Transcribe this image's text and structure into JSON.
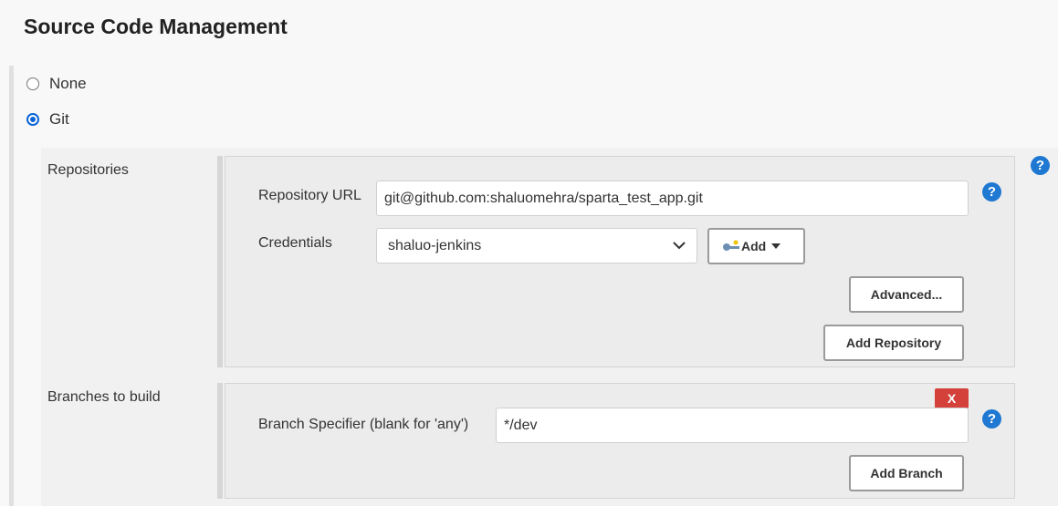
{
  "section": {
    "title": "Source Code Management"
  },
  "scm_options": [
    {
      "label": "None",
      "selected": false
    },
    {
      "label": "Git",
      "selected": true
    }
  ],
  "repositories": {
    "label": "Repositories",
    "repository_url_label": "Repository URL",
    "repository_url_value": "git@github.com:shaluomehra/sparta_test_app.git",
    "credentials_label": "Credentials",
    "credentials_value": "shaluo-jenkins",
    "add_label": "Add",
    "advanced_label": "Advanced...",
    "add_repository_label": "Add Repository"
  },
  "branches": {
    "label": "Branches to build",
    "delete_label": "X",
    "branch_specifier_label": "Branch Specifier (blank for 'any')",
    "branch_specifier_value": "*/dev",
    "add_branch_label": "Add Branch"
  },
  "help_glyph": "?",
  "colors": {
    "accent": "#1f78d1",
    "delete": "#d4403a"
  }
}
